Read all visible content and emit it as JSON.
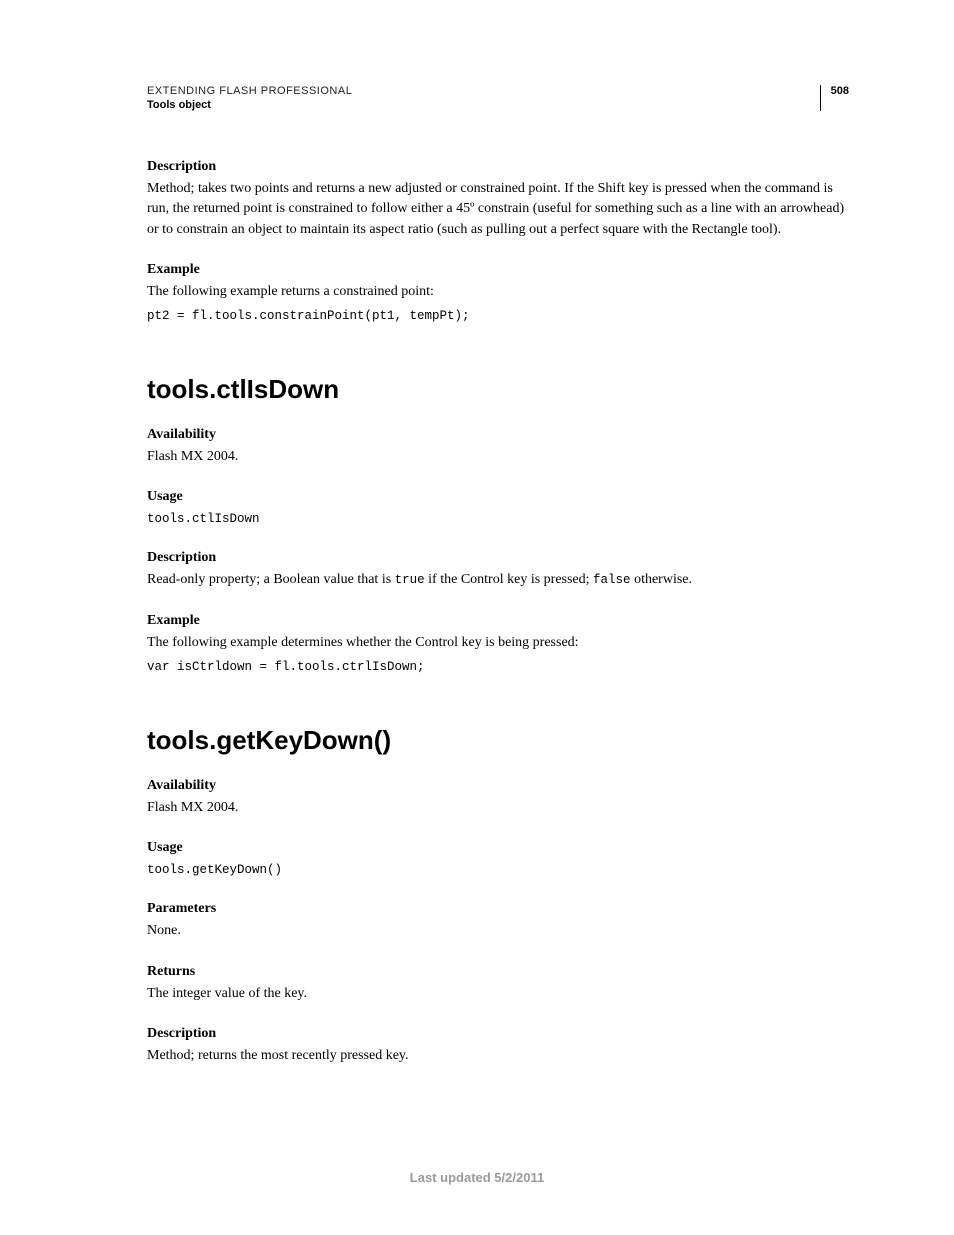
{
  "header": {
    "title": "EXTENDING FLASH PROFESSIONAL",
    "subtitle": "Tools object",
    "page_number": "508"
  },
  "s1": {
    "desc_label": "Description",
    "desc_text": "Method; takes two points and returns a new adjusted or constrained point. If the Shift key is pressed when the command is run, the returned point is constrained to follow either a 45º constrain (useful for something such as a line with an arrowhead) or to constrain an object to maintain its aspect ratio (such as pulling out a perfect square with the Rectangle tool).",
    "ex_label": "Example",
    "ex_text": "The following example returns a constrained point:",
    "ex_code": "pt2 = fl.tools.constrainPoint(pt1, tempPt);"
  },
  "s2": {
    "heading": "tools.ctlIsDown",
    "avail_label": "Availability",
    "avail_text": "Flash MX 2004.",
    "usage_label": "Usage",
    "usage_code": "tools.ctlIsDown",
    "desc_label": "Description",
    "desc_pre": "Read-only property; a Boolean value that is ",
    "desc_true": "true",
    "desc_mid": " if the Control key is pressed; ",
    "desc_false": "false",
    "desc_post": " otherwise.",
    "ex_label": "Example",
    "ex_text": "The following example determines whether the Control key is being pressed:",
    "ex_code": "var isCtrldown = fl.tools.ctrlIsDown;"
  },
  "s3": {
    "heading": "tools.getKeyDown()",
    "avail_label": "Availability",
    "avail_text": "Flash MX 2004.",
    "usage_label": "Usage",
    "usage_code": "tools.getKeyDown()",
    "params_label": "Parameters",
    "params_text": "None.",
    "returns_label": "Returns",
    "returns_text": "The integer value of the key.",
    "desc_label": "Description",
    "desc_text": "Method; returns the most recently pressed key."
  },
  "footer": {
    "text": "Last updated 5/2/2011"
  }
}
